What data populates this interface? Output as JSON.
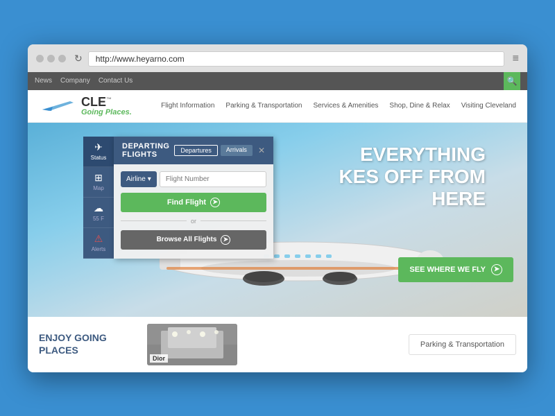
{
  "browser": {
    "url": "http://www.heyarno.com",
    "dots": [
      "dot1",
      "dot2",
      "dot3"
    ]
  },
  "topnav": {
    "links": [
      "News",
      "Company",
      "Contact Us"
    ],
    "search_label": "🔍"
  },
  "mainnav": {
    "logo_cle": "CLE",
    "logo_tm": "™",
    "logo_tagline": "Going Places.",
    "links": [
      "Flight Information",
      "Parking & Transportation",
      "Services & Amenities",
      "Shop, Dine & Relax",
      "Visiting Cleveland"
    ]
  },
  "hero": {
    "line1": "EVERYTHING",
    "line2": "KES OFF FROM",
    "line3": "HERE"
  },
  "sidebar": {
    "items": [
      {
        "icon": "✈",
        "label": "Status"
      },
      {
        "icon": "🗺",
        "label": "Map"
      },
      {
        "icon": "🌤",
        "label": "55 F"
      },
      {
        "icon": "⚠",
        "label": "Alerts"
      }
    ]
  },
  "flight_panel": {
    "title": "DEPARTING FLIGHTS",
    "tab_departures": "Departures",
    "tab_arrivals": "Arrivals",
    "airline_label": "Airline",
    "flight_number_placeholder": "Flight Number",
    "find_button": "Find Flight",
    "or_text": "or",
    "browse_button": "Browse All Flights"
  },
  "see_fly": {
    "label": "SEE WHERE WE FLY"
  },
  "bottom": {
    "enjoy_title": "ENJOY GOING\nPLACES",
    "dior_label": "Dior",
    "parking_label": "Parking & Transportation"
  },
  "colors": {
    "blue": "#3d5a80",
    "green": "#5cb85c",
    "gray": "#666666",
    "bg_blue": "#3a8fd1"
  }
}
